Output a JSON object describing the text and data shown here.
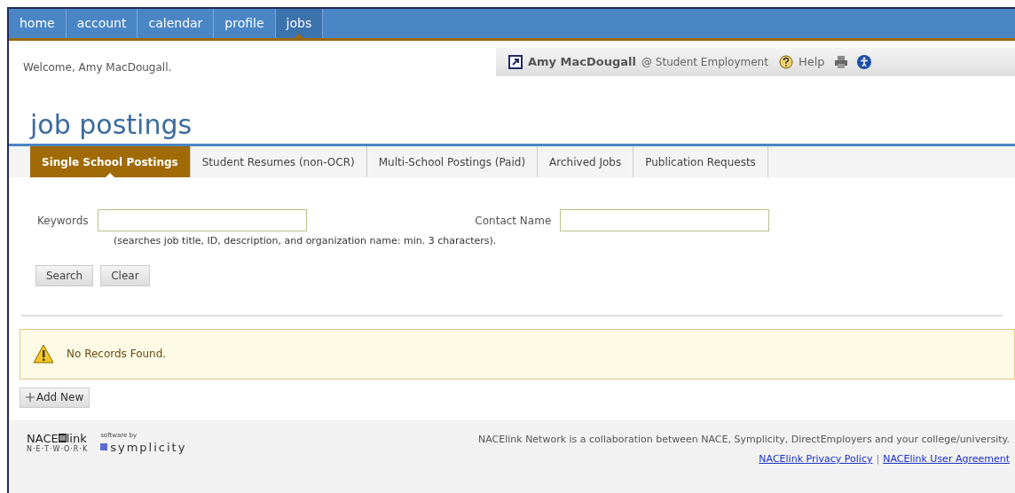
{
  "nav": [
    {
      "label": "home",
      "selected": false
    },
    {
      "label": "account",
      "selected": false
    },
    {
      "label": "calendar",
      "selected": false
    },
    {
      "label": "profile",
      "selected": false
    },
    {
      "label": "jobs",
      "selected": true
    }
  ],
  "welcome": "Welcome, Amy MacDougall.",
  "user_bar": {
    "name": "Amy MacDougall",
    "org": "@ Student Employment",
    "help": "Help"
  },
  "title": "job postings",
  "tabs": [
    {
      "label": "Single School Postings",
      "selected": true
    },
    {
      "label": "Student Resumes (non-OCR)",
      "selected": false
    },
    {
      "label": "Multi-School Postings (Paid)",
      "selected": false
    },
    {
      "label": "Archived Jobs",
      "selected": false
    },
    {
      "label": "Publication Requests",
      "selected": false
    }
  ],
  "form": {
    "keywords_label": "Keywords",
    "keywords_hint": "(searches job title, ID, description, and organization name: min. 3 characters).",
    "contact_label": "Contact Name",
    "buttons": [
      "Search",
      "Clear"
    ]
  },
  "alert": "No Records Found.",
  "add_button": "Add New",
  "footer": {
    "logo": {
      "nace": "NACE",
      "link": "link",
      "network": "N·E·T·W·O·R·K",
      "software_by": "software by",
      "symplicity": "symplicity"
    },
    "text": "NACElink Network is a collaboration between NACE, Symplicity, DirectEmployers and your college/university.",
    "links": [
      "NACElink Privacy Policy",
      "NACElink User Agreement"
    ],
    "separator": "|"
  }
}
